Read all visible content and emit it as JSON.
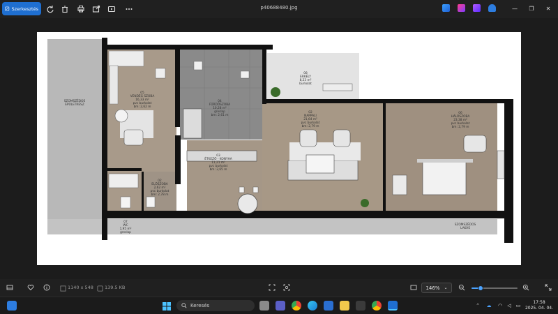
{
  "toolbar": {
    "edit_label": "Szerkesztés",
    "icons": [
      "rotate-icon",
      "delete-icon",
      "print-icon",
      "share-icon",
      "slideshow-icon",
      "more-icon"
    ],
    "filename": "p40688480.jpg",
    "right_apps": [
      "app-icon-1",
      "app-icon-2",
      "app-icon-3",
      "app-icon-4"
    ],
    "window_controls": [
      "minimize-icon",
      "maximize-icon",
      "close-icon"
    ]
  },
  "floorplan": {
    "rooms": [
      {
        "num": "05",
        "name": "VENDÉG SZOBA",
        "area": "16,33 m²",
        "floor": "pvc burkolat",
        "height": "bm: 2,62 m"
      },
      {
        "num": "04",
        "name": "FÜRDŐSZOBA",
        "area": "10,28 m²",
        "floor": "greslap",
        "height": "bm: 2,61 m"
      },
      {
        "num": "08",
        "name": "ERKÉLY",
        "area": "8,23 m²",
        "floor": "burkolat",
        "height": ""
      },
      {
        "num": "02",
        "name": "NAPPALI",
        "area": "21,64 m²",
        "floor": "pvc burkolat",
        "height": "bm: 2,79 m"
      },
      {
        "num": "06",
        "name": "HÁLÓSZOBA",
        "area": "23,38 m²",
        "floor": "pvc burkolat",
        "height": "bm: 2,79 m"
      },
      {
        "num": "03",
        "name": "ÉTKEZŐ - KONYHA",
        "area": "11,21 m²",
        "floor": "pvc burkolat",
        "height": "bm: 2,65 m"
      },
      {
        "num": "02",
        "name": "ELŐSZOBA",
        "area": "2,62 m²",
        "floor": "pvc burkolat",
        "height": "bm: 2,78 m"
      },
      {
        "num": "07",
        "name": "WC",
        "area": "1,95 m²",
        "floor": "greslap",
        "height": ""
      }
    ],
    "neighbor_left": "SZOMSZÉDOS\nÉPÜLETRÉSZ",
    "neighbor_right": "SZOMSZÉDOS\nLAKÁS"
  },
  "status": {
    "dimensions": "1140 x 548",
    "filesize": "139.5 KB",
    "zoom": "146%",
    "zoom_fraction": 0.2
  },
  "taskbar": {
    "search_placeholder": "Keresés",
    "time": "17:58",
    "date": "2025. 04. 04.",
    "colors": {
      "accent": "#1f6fd1",
      "slider": "#4ba3ff"
    }
  }
}
